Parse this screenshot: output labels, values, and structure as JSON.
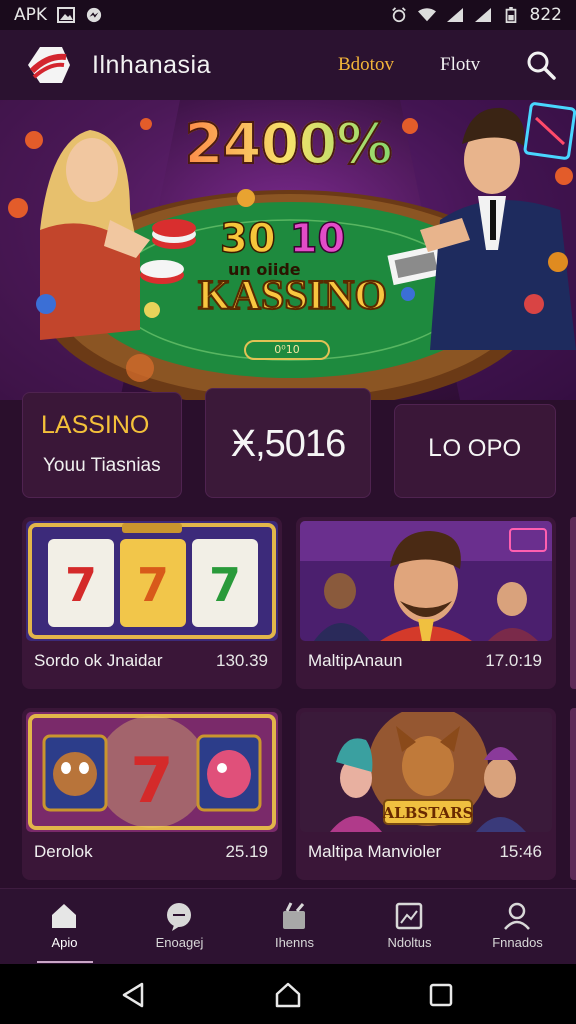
{
  "status_bar": {
    "left_text": "APK",
    "time": "822",
    "icons": [
      "image-icon",
      "messenger-icon",
      "alarm-icon",
      "wifi-icon",
      "signal-icon",
      "signal-icon",
      "battery-icon"
    ]
  },
  "header": {
    "brand": "Ilnhanasia",
    "nav": [
      {
        "label": "Bdotov",
        "active": true
      },
      {
        "label": "Flotv",
        "active": false
      }
    ],
    "search_icon": "search-icon",
    "accent": "#f2b43a"
  },
  "hero": {
    "percent_text": "2400%",
    "num1": "30",
    "num2": "10",
    "subtitle": "un oiide",
    "title": "KASSINO",
    "badge": "0⁰10"
  },
  "stats": [
    {
      "title": "LASSINO",
      "subtitle": "Youu Tiasnias"
    },
    {
      "value": "Ӿ,5016"
    },
    {
      "value": "ᏞO OPO"
    }
  ],
  "games": [
    {
      "name": "Sordo ok Jnaidar",
      "meta": "130.39",
      "art": "slot-777"
    },
    {
      "name": "MaltipAnaun",
      "meta": "17.0:19",
      "art": "casino-characters"
    },
    {
      "name": "Derolok",
      "meta": "25.19",
      "art": "slot-animals"
    },
    {
      "name": "Maltipa Manvioler",
      "meta": "15:46",
      "art": "adventure"
    }
  ],
  "bottom_nav": [
    {
      "label": "Apio",
      "icon": "home-icon",
      "active": true
    },
    {
      "label": "Enoagej",
      "icon": "chat-icon",
      "active": false
    },
    {
      "label": "Ihenns",
      "icon": "games-icon",
      "active": false
    },
    {
      "label": "Ndoltus",
      "icon": "image-icon",
      "active": false
    },
    {
      "label": "Fnnados",
      "icon": "profile-icon",
      "active": false
    }
  ],
  "colors": {
    "background": "#2a0f2c",
    "card": "#3a1638",
    "gold": "#f4c13a"
  }
}
